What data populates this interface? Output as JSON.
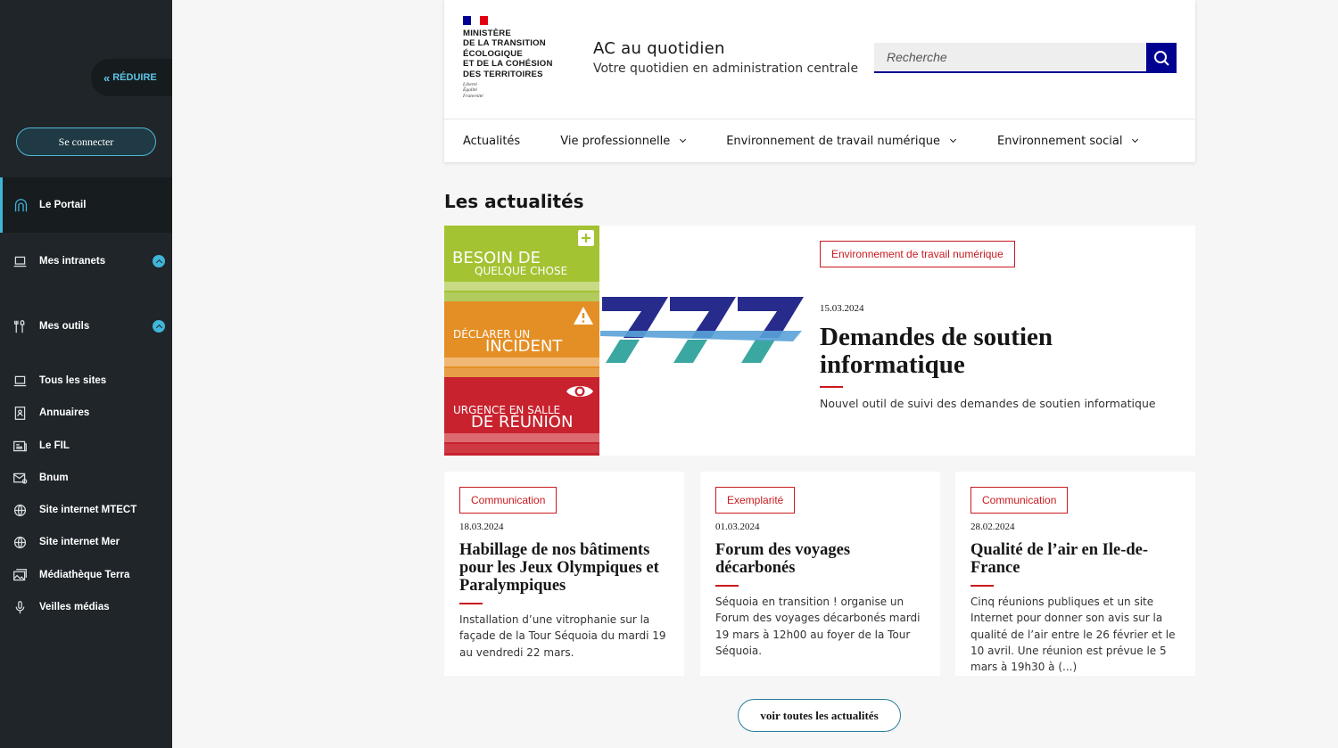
{
  "sidebar": {
    "reduce_label": "RÉDUIRE",
    "connect_label": "Se connecter",
    "items": [
      {
        "label": "Le Portail",
        "icon": "arch-icon"
      },
      {
        "label": "Mes intranets",
        "icon": "laptop-icon"
      },
      {
        "label": "Mes outils",
        "icon": "tools-icon"
      },
      {
        "label": "Tous les sites",
        "icon": "laptop-icon"
      },
      {
        "label": "Annuaires",
        "icon": "contact-book-icon"
      },
      {
        "label": "Le FIL",
        "icon": "news-icon"
      },
      {
        "label": "Bnum",
        "icon": "mail-icon"
      },
      {
        "label": "Site internet MTECT",
        "icon": "globe-icon"
      },
      {
        "label": "Site internet Mer",
        "icon": "globe-icon"
      },
      {
        "label": "Médiathèque Terra",
        "icon": "gallery-icon"
      },
      {
        "label": "Veilles médias",
        "icon": "microphone-icon"
      }
    ]
  },
  "header": {
    "logo_lines": [
      "Ministère",
      "de la transition",
      "écologique",
      "et de la cohésion",
      "des territoires"
    ],
    "devise": [
      "Liberté",
      "Égalité",
      "Fraternité"
    ],
    "service_title": "AC au quotidien",
    "service_tagline": "Votre quotidien en administration centrale",
    "search_placeholder": "Recherche",
    "menu": [
      {
        "label": "Actualités",
        "dropdown": false
      },
      {
        "label": "Vie professionnelle",
        "dropdown": true
      },
      {
        "label": "Environnement de travail numérique",
        "dropdown": true
      },
      {
        "label": "Environnement social",
        "dropdown": true
      }
    ]
  },
  "news": {
    "section_title": "Les actualités",
    "featured": {
      "image_tiles": [
        {
          "line1": "BESOIN DE",
          "line2": "QUELQUE CHOSE"
        },
        {
          "line1": "DÉCLARER UN",
          "line2": "INCIDENT"
        },
        {
          "line1": "URGENCE EN SALLE",
          "line2": "DE RÉUNION"
        }
      ],
      "badge": "Environnement de travail numérique",
      "date": "15.03.2024",
      "title": "Demandes de soutien informatique",
      "description": "Nouvel outil de suivi des demandes de soutien informatique"
    },
    "cards": [
      {
        "badge": "Communication",
        "date": "18.03.2024",
        "title": "Habillage de nos bâtiments pour les Jeux Olympiques et Paralympiques",
        "description": "Installation d’une vitrophanie sur la façade de la Tour Séquoia du mardi 19 au vendredi 22 mars."
      },
      {
        "badge": "Exemplarité",
        "date": "01.03.2024",
        "title": "Forum des voyages décarbonés",
        "description": "Séquoia en transition ! organise un Forum des voyages décarbonés mardi 19 mars à 12h00 au foyer de la Tour Séquoia."
      },
      {
        "badge": "Communication",
        "date": "28.02.2024",
        "title": "Qualité de l’air en Ile-de-France",
        "description": "Cinq réunions publiques et un site Internet pour donner son avis sur la qualité de l’air entre le 26 février et le 10 avril. Une réunion est prévue le 5 mars à 19h30 à (...)"
      }
    ],
    "more_label": "voir toutes les actualités"
  },
  "colors": {
    "sidebar_bg": "#1f2529",
    "accent_cyan": "#3fb5d9",
    "marianne_blue": "#000091",
    "badge_red": "#c9191e",
    "tile_green": "#a3c332",
    "tile_orange": "#e48f26",
    "tile_red": "#c8222e"
  }
}
